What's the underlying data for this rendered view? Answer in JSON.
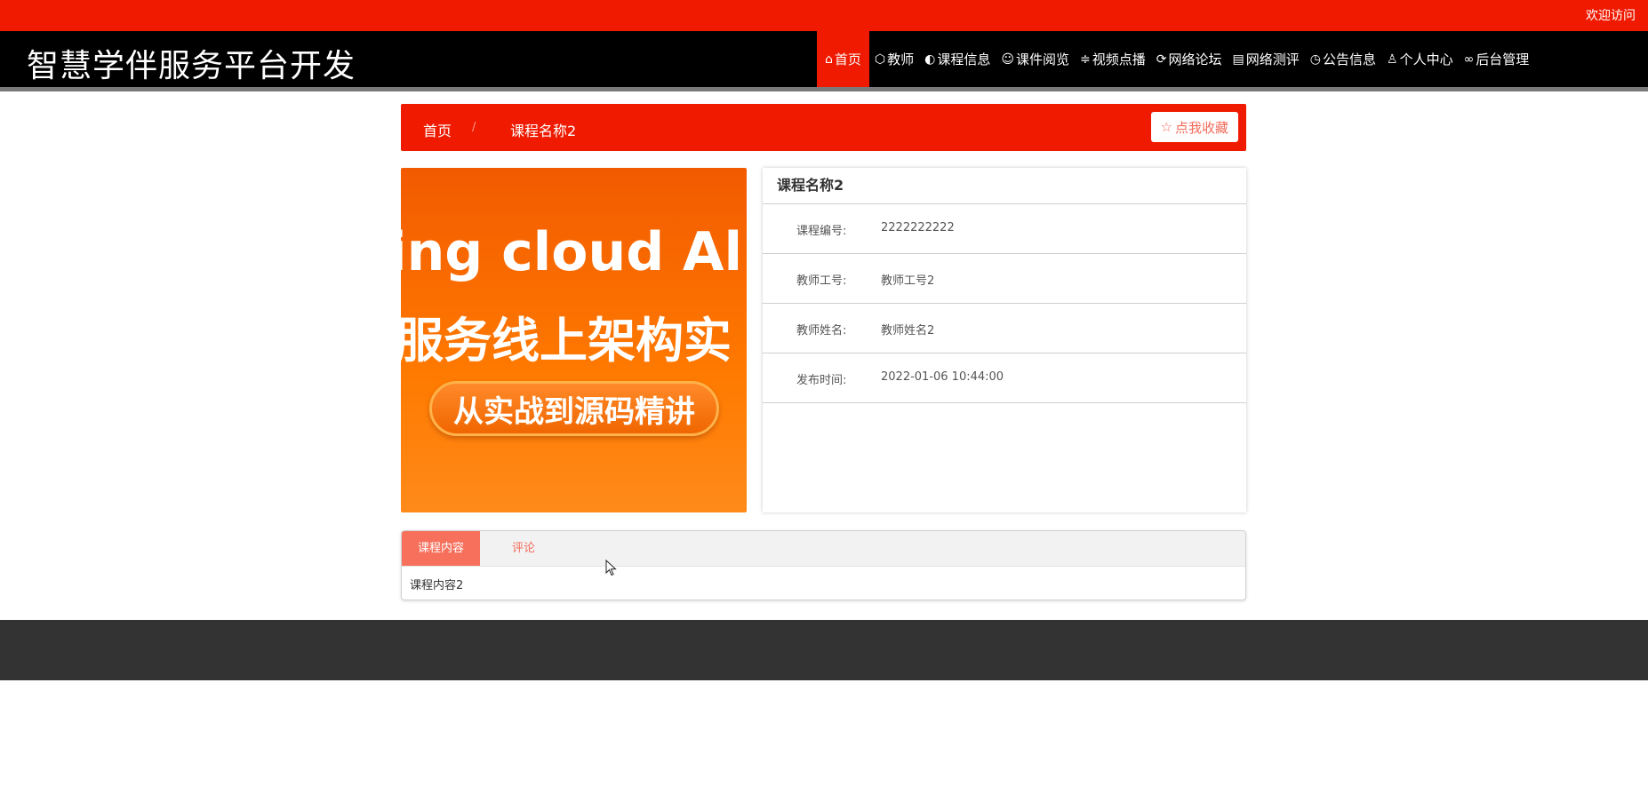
{
  "topbar": {
    "welcome": "欢迎访问"
  },
  "site": {
    "title": "智慧学伴服务平台开发"
  },
  "nav": [
    {
      "icon": "home-icon",
      "glyph": "⌂",
      "label": "首页",
      "active": true
    },
    {
      "icon": "cube-icon",
      "glyph": "⬡",
      "label": "教师"
    },
    {
      "icon": "palette-icon",
      "glyph": "◐",
      "label": "课程信息"
    },
    {
      "icon": "smile-icon",
      "glyph": "☺",
      "label": "课件阅览"
    },
    {
      "icon": "sliders-icon",
      "glyph": "≑",
      "label": "视频点播"
    },
    {
      "icon": "refresh-icon",
      "glyph": "⟳",
      "label": "网络论坛"
    },
    {
      "icon": "document-icon",
      "glyph": "▤",
      "label": "网络测评"
    },
    {
      "icon": "clock-icon",
      "glyph": "◷",
      "label": "公告信息"
    },
    {
      "icon": "user-icon",
      "glyph": "♙",
      "label": "个人中心"
    },
    {
      "icon": "link-icon",
      "glyph": "∞",
      "label": "后台管理"
    }
  ],
  "breadcrumb": {
    "home": "首页",
    "separator": "/",
    "current": "课程名称2",
    "favorite_label": "点我收藏"
  },
  "cover": {
    "line1": "ing cloud Alib",
    "line2": "服务线上架构实",
    "pill": "从实战到源码精讲"
  },
  "detail": {
    "title": "课程名称2",
    "rows": [
      {
        "label": "课程编号:",
        "value": "2222222222"
      },
      {
        "label": "教师工号:",
        "value": "教师工号2"
      },
      {
        "label": "教师姓名:",
        "value": "教师姓名2"
      },
      {
        "label": "发布时间:",
        "value": "2022-01-06 10:44:00"
      }
    ]
  },
  "tabs": {
    "items": [
      "课程内容",
      "评论"
    ],
    "content": "课程内容2"
  },
  "colors": {
    "accent": "#ef1a00",
    "header_bg": "#000000",
    "footer_bg": "#333333",
    "tab_active": "#f6705c"
  }
}
